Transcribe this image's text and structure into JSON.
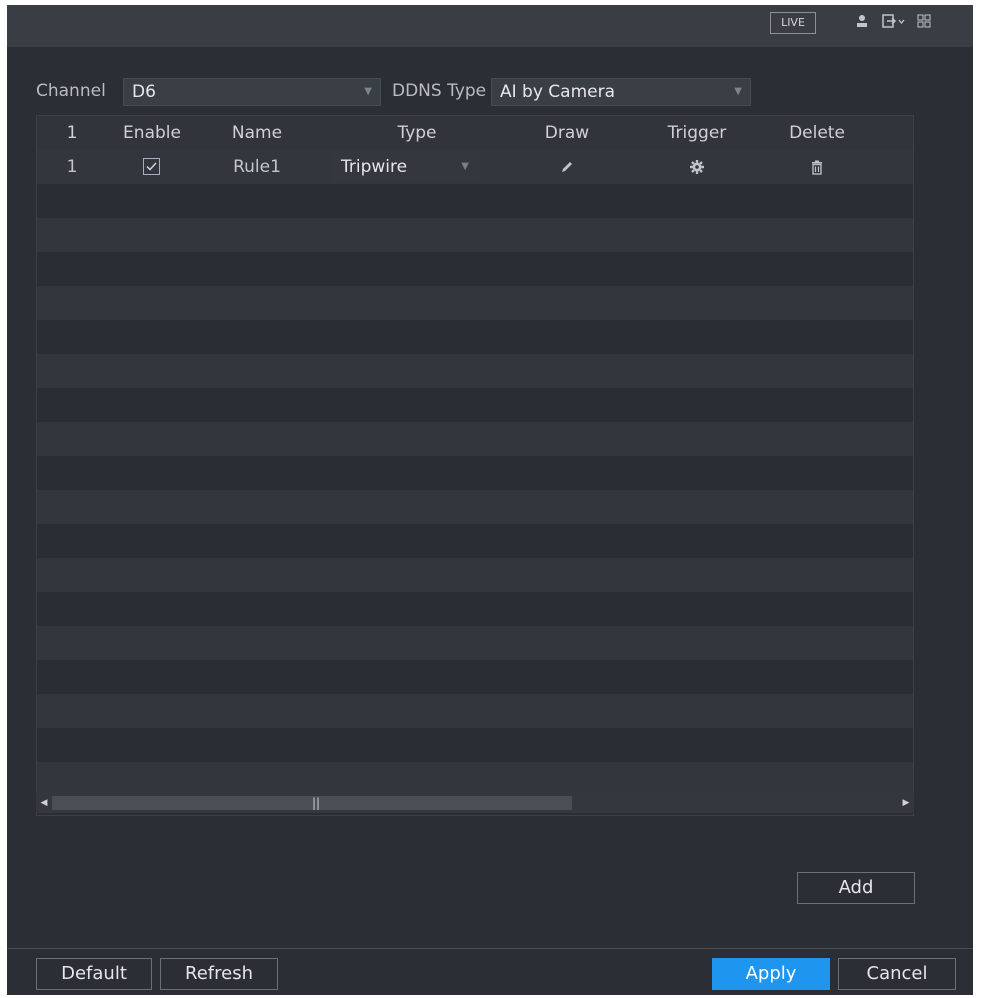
{
  "topbar": {
    "live_label": "LIVE",
    "icons": [
      "user-icon",
      "logout-icon",
      "menu-grid-icon"
    ]
  },
  "filters": {
    "channel_label": "Channel",
    "channel_value": "D6",
    "ddns_type_label": "DDNS Type",
    "ddns_type_value": "AI by Camera"
  },
  "table": {
    "columns": [
      "1",
      "Enable",
      "Name",
      "Type",
      "Draw",
      "Trigger",
      "Delete"
    ],
    "rows": [
      {
        "index": "1",
        "enabled": true,
        "name": "Rule1",
        "type": "Tripwire",
        "draw_icon": "pencil-icon",
        "trigger_icon": "gear-icon",
        "delete_icon": "trash-icon"
      }
    ]
  },
  "buttons": {
    "add": "Add",
    "default": "Default",
    "refresh": "Refresh",
    "apply": "Apply",
    "cancel": "Cancel"
  },
  "colors": {
    "accent": "#1e96f0",
    "background": "#2b2e34"
  }
}
